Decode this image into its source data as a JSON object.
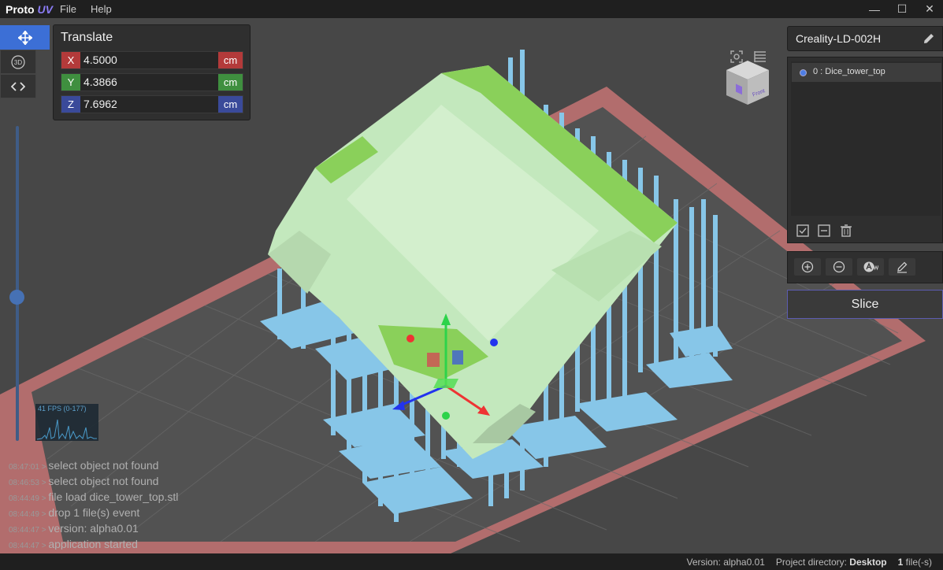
{
  "app": {
    "logo_text": "Proto",
    "logo_suffix": "UV",
    "menu": [
      "File",
      "Help"
    ]
  },
  "tools": {
    "items": [
      {
        "name": "translate",
        "icon": "move-arrows-icon",
        "active": true
      },
      {
        "name": "rotate-3d",
        "icon": "rotate-3d-icon",
        "label": "3D",
        "active": false
      },
      {
        "name": "code",
        "icon": "code-brackets-icon",
        "active": false
      }
    ]
  },
  "translate": {
    "title": "Translate",
    "x": {
      "label": "X",
      "value": "4.5000",
      "unit": "cm"
    },
    "y": {
      "label": "Y",
      "value": "4.3866",
      "unit": "cm"
    },
    "z": {
      "label": "Z",
      "value": "7.6962",
      "unit": "cm"
    }
  },
  "printer": {
    "name": "Creality-LD-002H"
  },
  "objects": [
    {
      "label": "0 : Dice_tower_top",
      "color": "#4e7ee6"
    }
  ],
  "slice_label": "Slice",
  "fps_label": "41 FPS (0-177)",
  "log": [
    {
      "ts": "08:47:01",
      "msg": "select object not found"
    },
    {
      "ts": "08:46:53",
      "msg": "select object not found"
    },
    {
      "ts": "08:44:49",
      "msg": "file load dice_tower_top.stl"
    },
    {
      "ts": "08:44:49",
      "msg": "drop 1 file(s) event"
    },
    {
      "ts": "08:44:47",
      "msg": "version: alpha0.01"
    },
    {
      "ts": "08:44:47",
      "msg": "application started"
    }
  ],
  "status": {
    "version_label": "Version:",
    "version_value": "alpha0.01",
    "project_label": "Project directory:",
    "project_value": "Desktop",
    "files_count": "1",
    "files_label": "file(-s)"
  },
  "view_cube": {
    "face_label": "Front"
  },
  "colors": {
    "accent": "#3c6fd6",
    "x_axis": "#b33a3a",
    "y_axis": "#3f8f3f",
    "z_axis": "#3a4a9a",
    "model": "#c3e8bd",
    "model_top": "#8ad05a",
    "supports": "#87c6e8",
    "bed_border": "#c57474"
  }
}
